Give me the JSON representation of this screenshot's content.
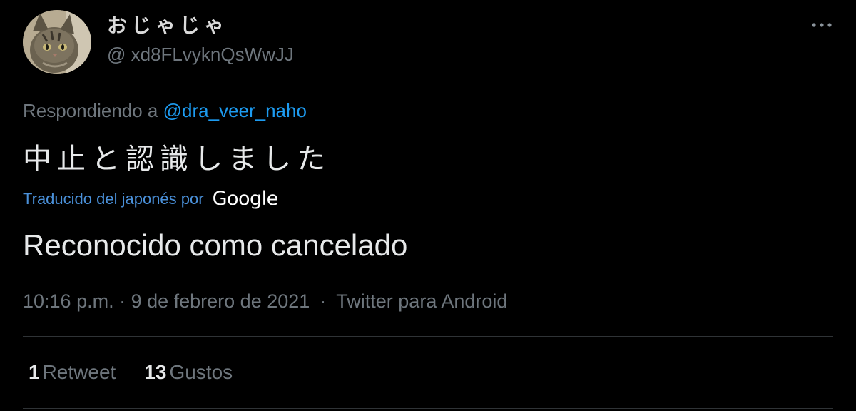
{
  "author": {
    "display_name": "おじゃじゃ",
    "username": "@ xd8FLvyknQsWwJJ",
    "avatar": "cat-avatar"
  },
  "menu": {
    "icon": "more-horizontal-icon"
  },
  "reply": {
    "prefix": "Respondiendo a",
    "mention": "@dra_veer_naho"
  },
  "tweet": {
    "text": "中止と認識しました"
  },
  "translation": {
    "credit": "Traducido del japonés por",
    "provider": "Google",
    "text": "Reconocido como cancelado"
  },
  "meta": {
    "timestamp": "10:16 p.m. · 9 de febrero de 2021",
    "separator": "·",
    "source": "Twitter para Android"
  },
  "stats": {
    "retweets_count": "1",
    "retweets_label": "Retweet",
    "likes_count": "13",
    "likes_label": "Gustos"
  },
  "colors": {
    "background": "#000000",
    "link": "#1d9bf0",
    "secondary_text": "#6e767d"
  }
}
